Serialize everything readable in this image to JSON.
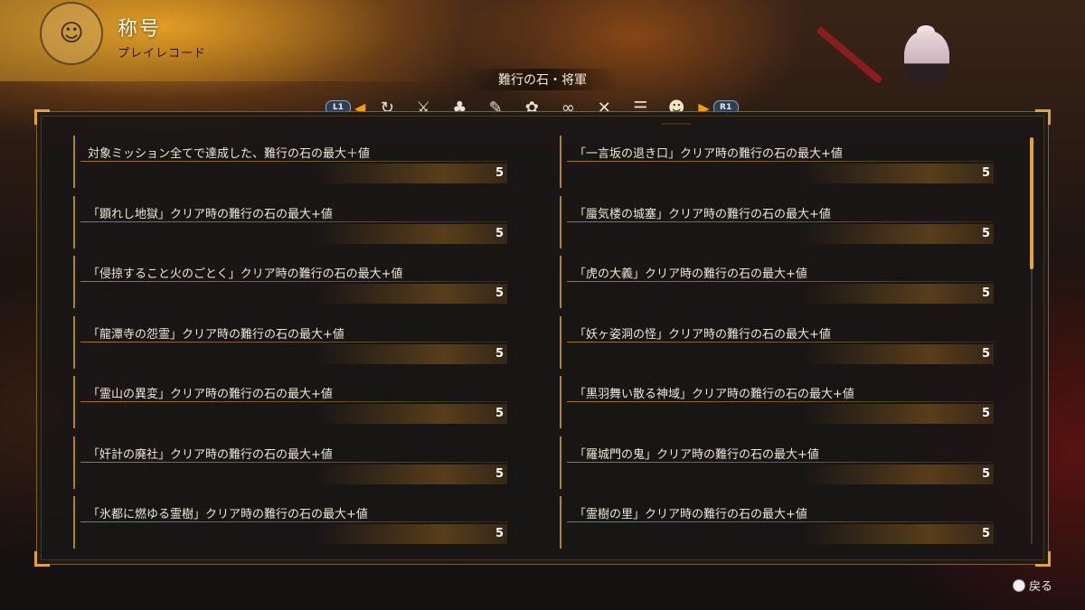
{
  "header": {
    "title": "称号",
    "subtitle": "プレイレコード",
    "emblem_icon": "character-portrait-emblem-icon"
  },
  "category": {
    "label": "難行の石・将軍"
  },
  "tabs": {
    "left_button": "L1",
    "right_button": "R1",
    "items": [
      {
        "icon": "swirl-icon",
        "glyph": "↻"
      },
      {
        "icon": "samurai-icon",
        "glyph": "⚔"
      },
      {
        "icon": "crowd-icon",
        "glyph": "♣"
      },
      {
        "icon": "scroll-icon",
        "glyph": "✎"
      },
      {
        "icon": "spirit-icon",
        "glyph": "✿"
      },
      {
        "icon": "chain-icon",
        "glyph": "∞"
      },
      {
        "icon": "crossed-swords-icon",
        "glyph": "✕"
      },
      {
        "icon": "document-icon",
        "glyph": "☰"
      },
      {
        "icon": "general-mask-icon",
        "glyph": "☻",
        "active": true
      }
    ]
  },
  "records_left": [
    {
      "title": "対象ミッション全てで達成した、難行の石の最大＋値",
      "value": "5"
    },
    {
      "title": "「顕れし地獄」クリア時の難行の石の最大+値",
      "value": "5"
    },
    {
      "title": "「侵掠すること火のごとく」クリア時の難行の石の最大+値",
      "value": "5"
    },
    {
      "title": "「龍潭寺の怨霊」クリア時の難行の石の最大+値",
      "value": "5"
    },
    {
      "title": "「霊山の異変」クリア時の難行の石の最大+値",
      "value": "5"
    },
    {
      "title": "「奸計の廃社」クリア時の難行の石の最大+値",
      "value": "5"
    },
    {
      "title": "「氷都に燃ゆる霊樹」クリア時の難行の石の最大+値",
      "value": "5"
    }
  ],
  "records_right": [
    {
      "title": "「一言坂の退き口」クリア時の難行の石の最大+値",
      "value": "5"
    },
    {
      "title": "「蜃気楼の城塞」クリア時の難行の石の最大+値",
      "value": "5"
    },
    {
      "title": "「虎の大義」クリア時の難行の石の最大+値",
      "value": "5"
    },
    {
      "title": "「妖ヶ姿洞の怪」クリア時の難行の石の最大+値",
      "value": "5"
    },
    {
      "title": "「黒羽舞い散る神域」クリア時の難行の石の最大+値",
      "value": "5"
    },
    {
      "title": "「羅城門の鬼」クリア時の難行の石の最大+値",
      "value": "5"
    },
    {
      "title": "「霊樹の里」クリア時の難行の石の最大+値",
      "value": "5"
    }
  ],
  "footer": {
    "back_label": "戻る",
    "back_button_icon": "circle-button-icon"
  },
  "colors": {
    "accent": "#e2a72a",
    "panel": "#181616"
  }
}
